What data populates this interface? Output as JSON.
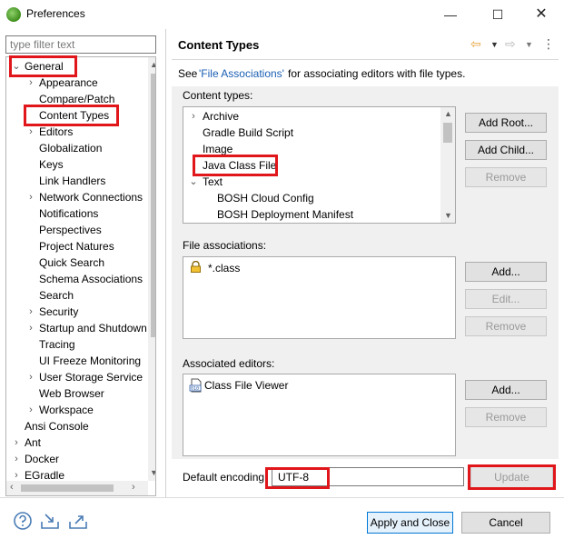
{
  "window": {
    "title": "Preferences",
    "minimize": "—",
    "maximize": "☐",
    "close": "✕"
  },
  "filter": {
    "placeholder": "type filter text"
  },
  "tree": {
    "items": [
      {
        "label": "General",
        "arrow": "⌄"
      },
      {
        "label": "Appearance",
        "arrow": "›"
      },
      {
        "label": "Compare/Patch",
        "arrow": ""
      },
      {
        "label": "Content Types",
        "arrow": ""
      },
      {
        "label": "Editors",
        "arrow": "›"
      },
      {
        "label": "Globalization",
        "arrow": ""
      },
      {
        "label": "Keys",
        "arrow": ""
      },
      {
        "label": "Link Handlers",
        "arrow": ""
      },
      {
        "label": "Network Connections",
        "arrow": "›"
      },
      {
        "label": "Notifications",
        "arrow": ""
      },
      {
        "label": "Perspectives",
        "arrow": ""
      },
      {
        "label": "Project Natures",
        "arrow": ""
      },
      {
        "label": "Quick Search",
        "arrow": ""
      },
      {
        "label": "Schema Associations",
        "arrow": ""
      },
      {
        "label": "Search",
        "arrow": ""
      },
      {
        "label": "Security",
        "arrow": "›"
      },
      {
        "label": "Startup and Shutdown",
        "arrow": "›"
      },
      {
        "label": "Tracing",
        "arrow": ""
      },
      {
        "label": "UI Freeze Monitoring",
        "arrow": ""
      },
      {
        "label": "User Storage Service",
        "arrow": "›"
      },
      {
        "label": "Web Browser",
        "arrow": ""
      },
      {
        "label": "Workspace",
        "arrow": "›"
      },
      {
        "label": "Ansi Console",
        "arrow": ""
      },
      {
        "label": "Ant",
        "arrow": "›"
      },
      {
        "label": "Docker",
        "arrow": "›"
      },
      {
        "label": "EGradle",
        "arrow": "›"
      }
    ]
  },
  "page": {
    "title": "Content Types",
    "see_prefix": "See",
    "see_link": "'File Associations'",
    "see_suffix": "for associating editors with file types.",
    "content_types_label": "Content types:",
    "content_types": [
      {
        "label": "Archive",
        "arrow": "›"
      },
      {
        "label": "Gradle Build Script",
        "arrow": ""
      },
      {
        "label": "Image",
        "arrow": ""
      },
      {
        "label": "Java Class File",
        "arrow": ""
      },
      {
        "label": "Text",
        "arrow": "⌄"
      },
      {
        "label": "BOSH Cloud Config",
        "arrow": ""
      },
      {
        "label": "BOSH Deployment Manifest",
        "arrow": ""
      }
    ],
    "add_root": "Add Root...",
    "add_child": "Add Child...",
    "remove": "Remove",
    "file_assoc_label": "File associations:",
    "file_assoc_items": [
      "*.class"
    ],
    "add": "Add...",
    "edit": "Edit...",
    "assoc_editors_label": "Associated editors:",
    "assoc_editors": [
      "Class File Viewer"
    ],
    "default_encoding_label": "Default encoding:",
    "default_encoding_value": "UTF-8",
    "update": "Update"
  },
  "footer": {
    "apply_close": "Apply and Close",
    "cancel": "Cancel"
  },
  "colors": {
    "highlight": "#e0161b",
    "link": "#1a5fb4",
    "panel": "#f0f0f0"
  }
}
